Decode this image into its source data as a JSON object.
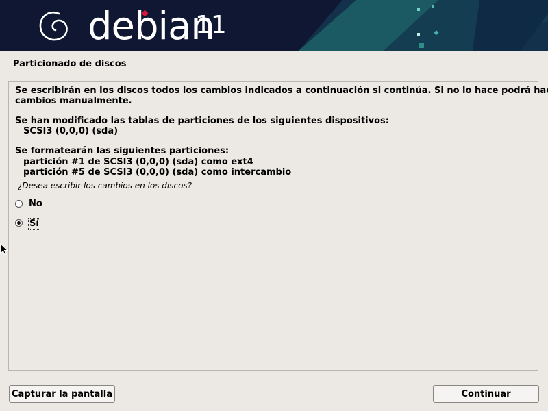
{
  "header": {
    "brand": "debian",
    "version": "11",
    "brand_color": "#0f1732",
    "accent_color": "#d7193b"
  },
  "page": {
    "title": "Particionado de discos"
  },
  "main": {
    "paragraph1_line1": "Se escribirán en los discos todos los cambios indicados a continuación si continúa. Si no lo hace podrá hacer",
    "paragraph1_line2": "cambios manualmente.",
    "devices_heading": "Se han modificado las tablas de particiones de los siguientes dispositivos:",
    "devices": [
      "SCSI3 (0,0,0) (sda)"
    ],
    "partitions_heading": "Se formatearán las siguientes particiones:",
    "partitions": [
      "partición #1 de SCSI3 (0,0,0) (sda) como ext4",
      "partición #5 de SCSI3 (0,0,0) (sda) como intercambio"
    ],
    "question": "¿Desea escribir los cambios en los discos?",
    "options": [
      {
        "label": "No",
        "selected": false
      },
      {
        "label": "Sí",
        "selected": true
      }
    ]
  },
  "footer": {
    "screenshot_button": "Capturar la pantalla",
    "continue_button": "Continuar"
  }
}
